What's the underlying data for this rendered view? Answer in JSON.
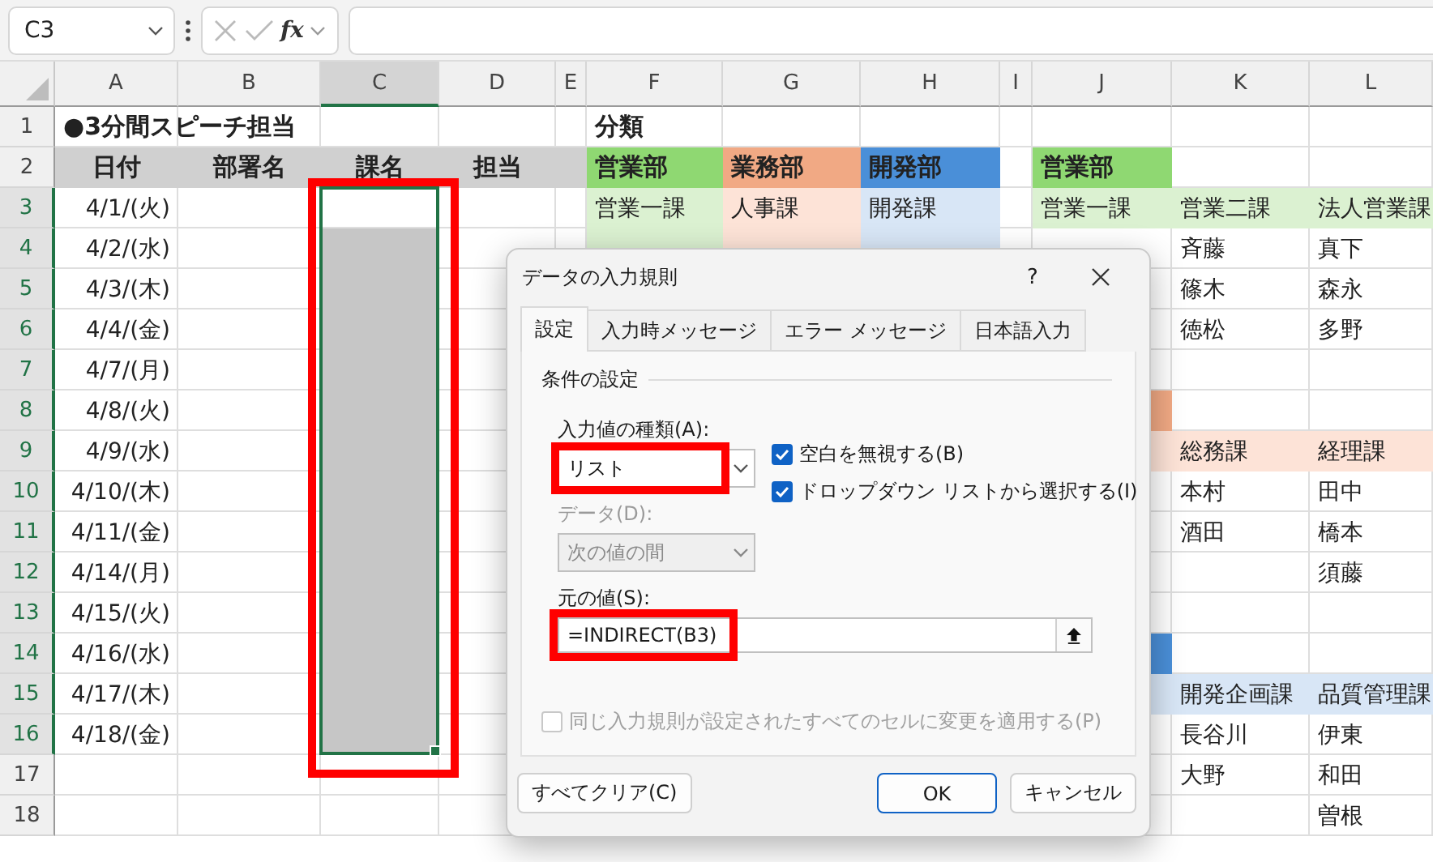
{
  "formula_bar": {
    "name_box": "C3",
    "function_label": "fx"
  },
  "sheet": {
    "columns": [
      {
        "label": "A",
        "selected": false
      },
      {
        "label": "B",
        "selected": false
      },
      {
        "label": "C",
        "selected": true
      },
      {
        "label": "D",
        "selected": false
      },
      {
        "label": "E",
        "selected": false
      },
      {
        "label": "F",
        "selected": false
      },
      {
        "label": "G",
        "selected": false
      },
      {
        "label": "H",
        "selected": false
      },
      {
        "label": "I",
        "selected": false
      },
      {
        "label": "J",
        "selected": false
      },
      {
        "label": "K",
        "selected": false
      },
      {
        "label": "L",
        "selected": false
      }
    ],
    "selection_highlighted": true,
    "rows": [
      {
        "number": "1",
        "selected": false,
        "cells": [
          {
            "text": "●3分間スピーチ担当",
            "kind": "title"
          },
          {},
          {},
          {},
          {},
          {
            "text": "分類",
            "kind": "title"
          },
          {},
          {},
          {},
          {},
          {},
          {}
        ]
      },
      {
        "number": "2",
        "selected": false,
        "cells": [
          {
            "text": "日付",
            "kind": "heading",
            "color": "#d0d0d0"
          },
          {
            "text": "部署名",
            "kind": "heading",
            "color": "#d0d0d0"
          },
          {
            "text": "課名",
            "kind": "heading",
            "color": "#d0d0d0"
          },
          {
            "text": "担当",
            "kind": "heading",
            "color": "#d0d0d0"
          },
          {
            "color": "#d0d0d0"
          },
          {
            "text": "営業部",
            "kind": "bold",
            "color": "#8fd872"
          },
          {
            "text": "業務部",
            "kind": "bold",
            "color": "#f1a984"
          },
          {
            "text": "開発部",
            "kind": "bold",
            "color": "#4a8fd8"
          },
          {},
          {
            "text": "営業部",
            "kind": "bold",
            "color": "#8fd872"
          },
          {},
          {}
        ]
      },
      {
        "number": "3",
        "selected": true,
        "cells": [
          {
            "text": "4/1/(火)",
            "kind": "date"
          },
          {},
          {},
          {},
          {},
          {
            "text": "営業一課",
            "color": "#dbf1d1"
          },
          {
            "text": "人事課",
            "color": "#fde3d7"
          },
          {
            "text": "開発課",
            "color": "#d8e6f6"
          },
          {},
          {
            "text": "営業一課",
            "color": "#dbf1d1"
          },
          {
            "text": "営業二課",
            "color": "#dbf1d1"
          },
          {
            "text": "法人営業課",
            "color": "#dbf1d1"
          }
        ]
      },
      {
        "number": "4",
        "selected": true,
        "cells": [
          {
            "text": "4/2/(水)",
            "kind": "date"
          },
          {},
          {},
          {},
          {},
          {
            "color": "#dbf1d1"
          },
          {
            "color": "#fde3d7"
          },
          {
            "color": "#d8e6f6"
          },
          {},
          {},
          {
            "text": "斉藤"
          },
          {
            "text": "真下"
          }
        ]
      },
      {
        "number": "5",
        "selected": true,
        "cells": [
          {
            "text": "4/3/(木)",
            "kind": "date"
          },
          {},
          {},
          {},
          {},
          {},
          {},
          {},
          {},
          {},
          {
            "text": "篠木"
          },
          {
            "text": "森永"
          }
        ]
      },
      {
        "number": "6",
        "selected": true,
        "cells": [
          {
            "text": "4/4/(金)",
            "kind": "date"
          },
          {},
          {},
          {},
          {},
          {},
          {},
          {},
          {},
          {},
          {
            "text": "徳松"
          },
          {
            "text": "多野"
          }
        ]
      },
      {
        "number": "7",
        "selected": true,
        "cells": [
          {
            "text": "4/7/(月)",
            "kind": "date"
          },
          {},
          {},
          {},
          {},
          {},
          {},
          {},
          {},
          {},
          {},
          {}
        ]
      },
      {
        "number": "8",
        "selected": true,
        "cells": [
          {
            "text": "4/8/(火)",
            "kind": "date"
          },
          {},
          {},
          {},
          {},
          {},
          {},
          {},
          {},
          {
            "color": "#f1a984"
          },
          {},
          {}
        ]
      },
      {
        "number": "9",
        "selected": true,
        "cells": [
          {
            "text": "4/9/(水)",
            "kind": "date"
          },
          {},
          {},
          {},
          {},
          {},
          {},
          {},
          {},
          {
            "color": "#fde3d7"
          },
          {
            "text": "総務課",
            "color": "#fde3d7"
          },
          {
            "text": "経理課",
            "color": "#fde3d7"
          }
        ]
      },
      {
        "number": "10",
        "selected": true,
        "cells": [
          {
            "text": "4/10/(木)",
            "kind": "date"
          },
          {},
          {},
          {},
          {},
          {},
          {},
          {},
          {},
          {},
          {
            "text": "本村"
          },
          {
            "text": "田中"
          }
        ]
      },
      {
        "number": "11",
        "selected": true,
        "cells": [
          {
            "text": "4/11/(金)",
            "kind": "date"
          },
          {},
          {},
          {},
          {},
          {},
          {},
          {},
          {},
          {},
          {
            "text": "酒田"
          },
          {
            "text": "橋本"
          }
        ]
      },
      {
        "number": "12",
        "selected": true,
        "cells": [
          {
            "text": "4/14/(月)",
            "kind": "date"
          },
          {},
          {},
          {},
          {},
          {},
          {},
          {},
          {},
          {},
          {},
          {
            "text": "須藤"
          }
        ]
      },
      {
        "number": "13",
        "selected": true,
        "cells": [
          {
            "text": "4/15/(火)",
            "kind": "date"
          },
          {},
          {},
          {},
          {},
          {},
          {},
          {},
          {},
          {},
          {},
          {}
        ]
      },
      {
        "number": "14",
        "selected": true,
        "cells": [
          {
            "text": "4/16/(水)",
            "kind": "date"
          },
          {},
          {},
          {},
          {},
          {},
          {},
          {},
          {},
          {
            "color": "#4a8fd8"
          },
          {},
          {}
        ]
      },
      {
        "number": "15",
        "selected": true,
        "cells": [
          {
            "text": "4/17/(木)",
            "kind": "date"
          },
          {},
          {},
          {},
          {},
          {},
          {},
          {},
          {},
          {
            "color": "#d8e6f6"
          },
          {
            "text": "開発企画課",
            "color": "#d8e6f6"
          },
          {
            "text": "品質管理課",
            "color": "#d8e6f6"
          }
        ]
      },
      {
        "number": "16",
        "selected": true,
        "cells": [
          {
            "text": "4/18/(金)",
            "kind": "date"
          },
          {},
          {},
          {},
          {},
          {},
          {},
          {},
          {},
          {},
          {
            "text": "長谷川"
          },
          {
            "text": "伊東"
          }
        ]
      },
      {
        "number": "17",
        "selected": false,
        "cells": [
          {},
          {},
          {},
          {},
          {},
          {},
          {},
          {},
          {},
          {},
          {
            "text": "大野"
          },
          {
            "text": "和田"
          }
        ]
      },
      {
        "number": "18",
        "selected": false,
        "cells": [
          {},
          {},
          {},
          {},
          {},
          {},
          {},
          {},
          {},
          {},
          {},
          {
            "text": "曽根"
          }
        ]
      }
    ]
  },
  "dialog": {
    "title": "データの入力規則",
    "help": "?",
    "tabs": [
      {
        "label": "設定",
        "selected": true
      },
      {
        "label": "入力時メッセージ",
        "selected": false
      },
      {
        "label": "エラー メッセージ",
        "selected": false
      },
      {
        "label": "日本語入力",
        "selected": false
      }
    ],
    "group_title": "条件の設定",
    "allow_label": "入力値の種類(A):",
    "allow_value": "リスト",
    "allow_highlighted": true,
    "checkboxes": [
      {
        "label": "空白を無視する(B)",
        "checked": true
      },
      {
        "label": "ドロップダウン リストから選択する(I)",
        "checked": true
      }
    ],
    "data_label": "データ(D):",
    "data_value": "次の値の間",
    "data_disabled": true,
    "source_label": "元の値(S):",
    "source_value": "=INDIRECT(B3)",
    "source_highlighted": true,
    "apply_all": {
      "label": "同じ入力規則が設定されたすべてのセルに変更を適用する(P)",
      "checked": false,
      "disabled": true
    },
    "buttons": [
      {
        "label": "すべてクリア(C)",
        "kind": "plain"
      },
      {
        "label": "OK",
        "kind": "primary"
      },
      {
        "label": "キャンセル",
        "kind": "plain"
      }
    ]
  }
}
